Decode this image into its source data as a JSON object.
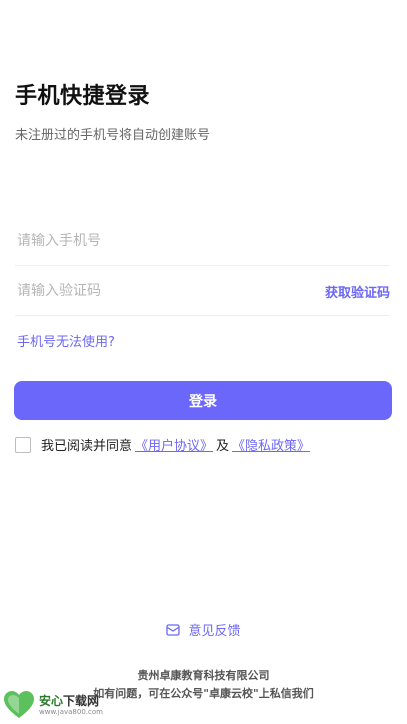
{
  "header": {
    "title": "手机快捷登录",
    "subtitle": "未注册过的手机号将自动创建账号"
  },
  "form": {
    "phone_placeholder": "请输入手机号",
    "code_placeholder": "请输入验证码",
    "get_code_label": "获取验证码",
    "phone_unusable_link": "手机号无法使用?",
    "login_button": "登录"
  },
  "agreement": {
    "prefix": "我已阅读并同意",
    "user_agreement": "《用户协议》",
    "and": "及",
    "privacy_policy": "《隐私政策》"
  },
  "footer": {
    "feedback_label": "意见反馈",
    "company": "贵州卓康教育科技有限公司",
    "contact": "如有问题，可在公众号\"卓康云校\"上私信我们"
  },
  "watermark": {
    "name_part1": "安心",
    "name_part2": "下载网",
    "url": "www.java800.com"
  },
  "colors": {
    "accent": "#6c67f5",
    "button": "#6c67fb"
  }
}
